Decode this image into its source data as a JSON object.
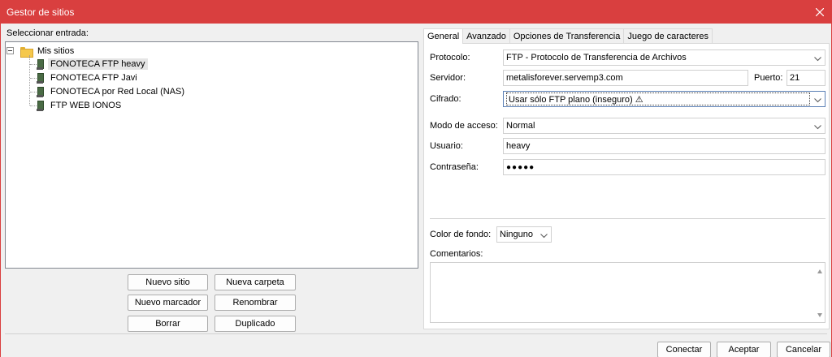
{
  "window": {
    "title": "Gestor de sitios"
  },
  "left": {
    "select_label": "Seleccionar entrada:",
    "tree": {
      "root": "Mis sitios",
      "items": [
        "FONOTECA FTP heavy",
        "FONOTECA FTP Javi",
        "FONOTECA por Red Local (NAS)",
        "FTP WEB IONOS"
      ],
      "selected": "FONOTECA FTP heavy"
    },
    "buttons": {
      "new_site": "Nuevo sitio",
      "new_folder": "Nueva carpeta",
      "new_bookmark": "Nuevo marcador",
      "rename": "Renombrar",
      "delete": "Borrar",
      "duplicate": "Duplicado"
    }
  },
  "tabs": [
    "General",
    "Avanzado",
    "Opciones de Transferencia",
    "Juego de caracteres"
  ],
  "general": {
    "protocol_label": "Protocolo:",
    "protocol_value": "FTP - Protocolo de Transferencia de Archivos",
    "server_label": "Servidor:",
    "server_value": "metalisforever.servemp3.com",
    "port_label": "Puerto:",
    "port_value": "21",
    "encryption_label": "Cifrado:",
    "encryption_value": "Usar sólo FTP plano (inseguro) ⚠",
    "access_label": "Modo de acceso:",
    "access_value": "Normal",
    "user_label": "Usuario:",
    "user_value": "heavy",
    "password_label": "Contraseña:",
    "password_value": "●●●●●",
    "bgcolor_label": "Color de fondo:",
    "bgcolor_value": "Ninguno",
    "comments_label": "Comentarios:"
  },
  "footer": {
    "connect": "Conectar",
    "accept": "Aceptar",
    "cancel": "Cancelar"
  },
  "colors": {
    "titlebar": "#d93f3f",
    "selection": "#e5e5e5"
  }
}
